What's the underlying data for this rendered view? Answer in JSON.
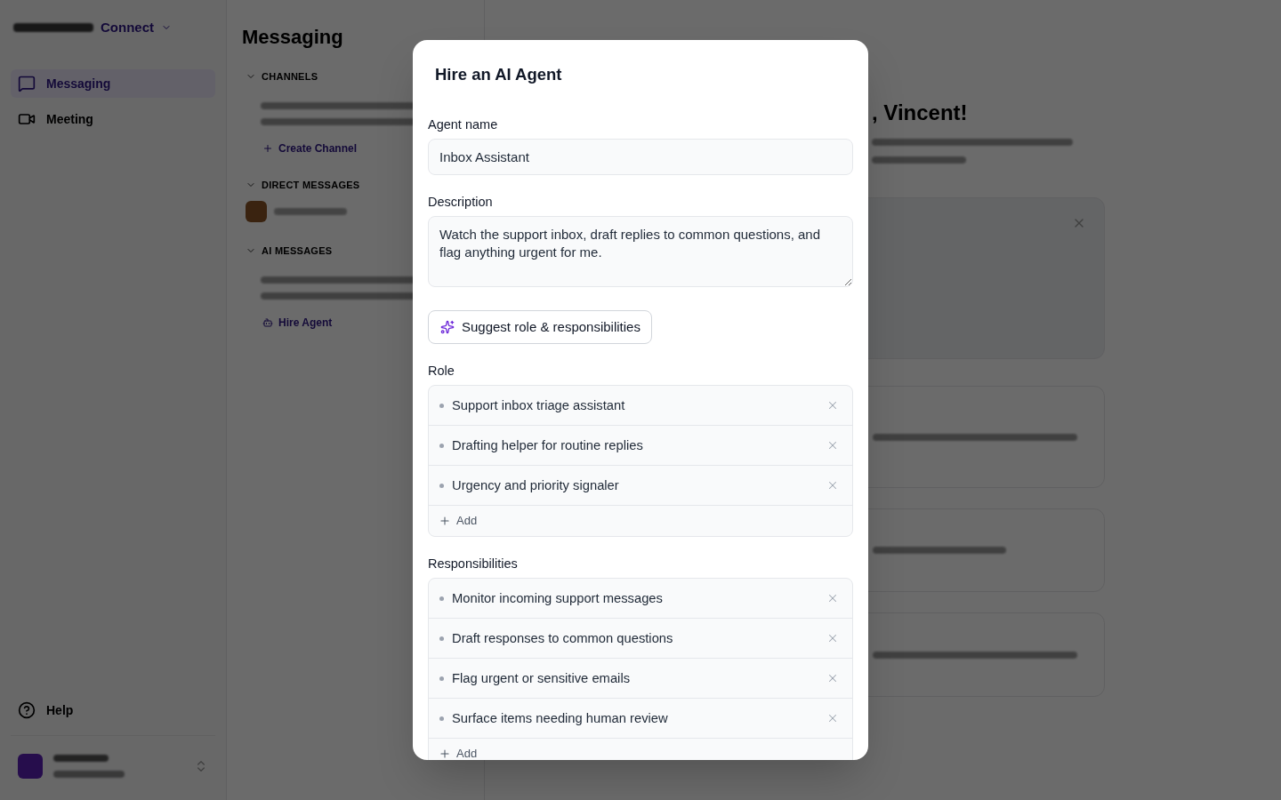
{
  "background": {
    "app_switcher": "Connect",
    "nav": [
      {
        "label": "Messaging",
        "selected": true
      },
      {
        "label": "Meeting",
        "selected": false
      }
    ],
    "help": "Help",
    "panel_title": "Messaging",
    "sections": [
      {
        "kind": "channels",
        "heading": "CHANNELS",
        "action": "Create Channel"
      },
      {
        "kind": "direct",
        "heading": "DIRECT MESSAGES"
      },
      {
        "kind": "agents",
        "heading": "AI MESSAGES",
        "action": "Hire Agent"
      }
    ],
    "greeting": ", Vincent!"
  },
  "modal": {
    "title": "Hire an AI Agent",
    "fields": [
      {
        "kind": "input",
        "label": "Agent name",
        "value": "Inbox Assistant"
      },
      {
        "kind": "textarea",
        "label": "Description",
        "value": "Watch the support inbox, draft replies to common questions, and flag anything urgent for me."
      }
    ],
    "suggest_button": "Suggest role & responsibilities",
    "lists": [
      {
        "label": "Role",
        "items": [
          "Support inbox triage assistant",
          "Drafting helper for routine replies",
          "Urgency and priority signaler"
        ],
        "add_label": "Add"
      },
      {
        "label": "Responsibilities",
        "items": [
          "Monitor incoming support messages",
          "Draft responses to common questions",
          "Flag urgent or sensitive emails",
          "Surface items needing human review"
        ],
        "add_label": "Add"
      }
    ]
  }
}
